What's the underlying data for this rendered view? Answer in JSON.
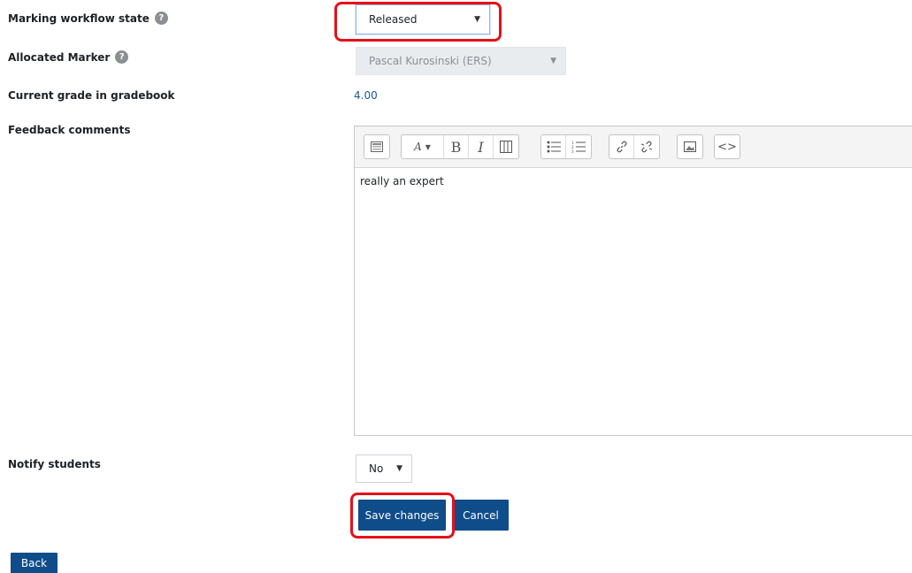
{
  "form": {
    "workflow": {
      "label": "Marking workflow state",
      "value": "Released"
    },
    "marker": {
      "label": "Allocated Marker",
      "value": "Pascal Kurosinski (ERS)"
    },
    "grade": {
      "label": "Current grade in gradebook",
      "value": "4.00"
    },
    "feedback": {
      "label": "Feedback comments",
      "text": "really an expert"
    },
    "notify": {
      "label": "Notify students",
      "value": "No"
    }
  },
  "toolbar": {
    "icons": [
      "show-more-icon",
      "font-style-icon",
      "bold-icon",
      "italic-icon",
      "table-icon",
      "unordered-list-icon",
      "ordered-list-icon",
      "link-icon",
      "unlink-icon",
      "image-icon",
      "html-icon"
    ],
    "bold_glyph": "B",
    "italic_glyph": "I"
  },
  "buttons": {
    "save": "Save changes",
    "cancel": "Cancel",
    "back": "Back"
  },
  "colors": {
    "primary": "#0f4c8a",
    "highlight": "#e5101a",
    "link": "#1b5a94"
  }
}
